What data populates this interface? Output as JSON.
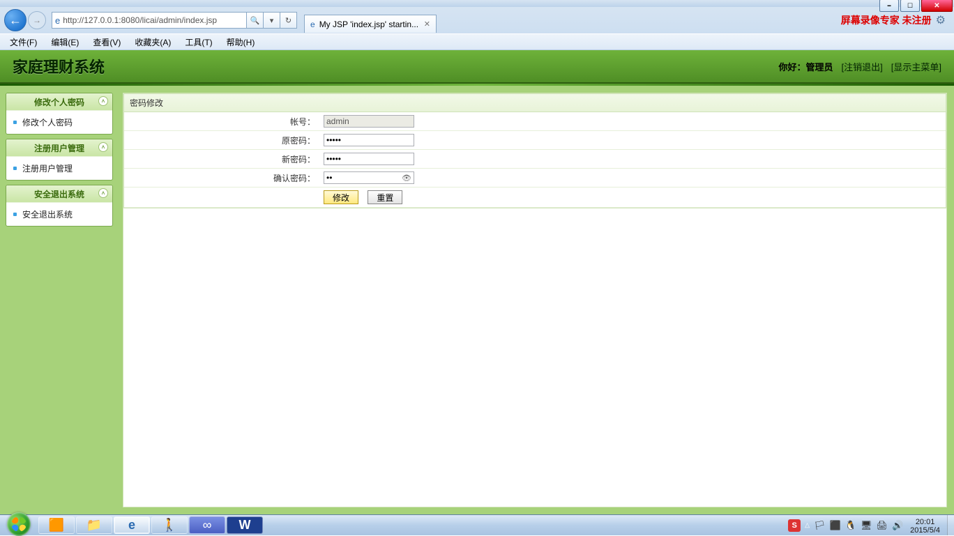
{
  "window": {
    "url": "http://127.0.0.1:8080/licai/admin/index.jsp",
    "tab_title": "My JSP 'index.jsp' startin...",
    "recorder_text": "屏幕录像专家 未注册"
  },
  "ie_menu": {
    "file": "文件(F)",
    "edit": "编辑(E)",
    "view": "查看(V)",
    "favorites": "收藏夹(A)",
    "tools": "工具(T)",
    "help": "帮助(H)"
  },
  "app": {
    "title": "家庭理财系统",
    "hello_prefix": "你好：",
    "hello_user": "管理员",
    "logout": "注销退出",
    "show_menu": "显示主菜单"
  },
  "sidebar": [
    {
      "head": "修改个人密码",
      "item": "修改个人密码"
    },
    {
      "head": "注册用户管理",
      "item": "注册用户管理"
    },
    {
      "head": "安全退出系统",
      "item": "安全退出系统"
    }
  ],
  "form": {
    "panel_title": "密码修改",
    "account_label": "帐号：",
    "account_value": "admin",
    "old_pwd_label": "原密码：",
    "old_pwd_value": "•••••",
    "new_pwd_label": "新密码：",
    "new_pwd_value": "•••••",
    "confirm_pwd_label": "确认密码：",
    "confirm_pwd_value": "••",
    "submit_label": "修改",
    "reset_label": "重置"
  },
  "taskbar": {
    "time": "20:01",
    "date": "2015/5/4",
    "sogou": "S"
  }
}
